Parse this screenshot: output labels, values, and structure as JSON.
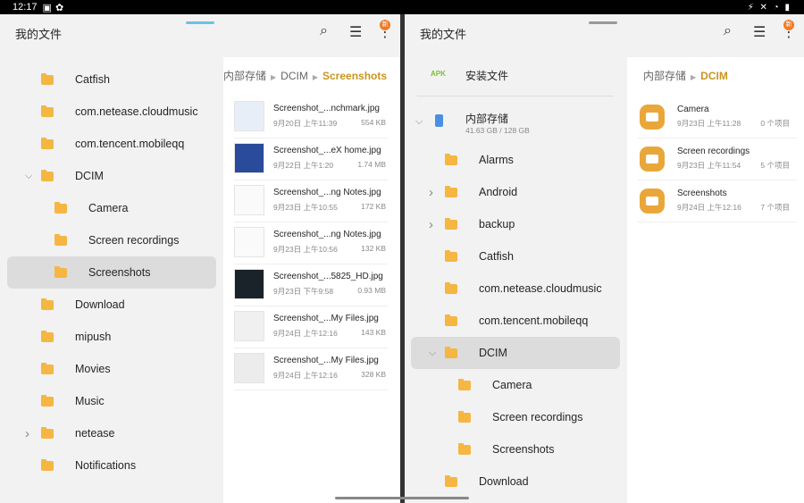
{
  "status": {
    "time": "12:17",
    "icons": [
      "gallery-icon",
      "settings-icon"
    ],
    "right_icons": "⚡ ✕ ◔ ▮"
  },
  "left": {
    "title": "我的文件",
    "badge": "新",
    "tree": [
      {
        "label": "Catfish",
        "level": 0
      },
      {
        "label": "com.netease.cloudmusic",
        "level": 0
      },
      {
        "label": "com.tencent.mobileqq",
        "level": 0
      },
      {
        "label": "DCIM",
        "level": 0,
        "expanded": true
      },
      {
        "label": "Camera",
        "level": 1
      },
      {
        "label": "Screen recordings",
        "level": 1
      },
      {
        "label": "Screenshots",
        "level": 1,
        "selected": true
      },
      {
        "label": "Download",
        "level": 0
      },
      {
        "label": "mipush",
        "level": 0
      },
      {
        "label": "Movies",
        "level": 0
      },
      {
        "label": "Music",
        "level": 0
      },
      {
        "label": "netease",
        "level": 0,
        "collapsed": true
      },
      {
        "label": "Notifications",
        "level": 0
      }
    ],
    "breadcrumb": [
      "内部存储",
      "DCIM",
      "Screenshots"
    ],
    "files": [
      {
        "name": "Screenshot_...nchmark.jpg",
        "date": "9月20日 上午11:39",
        "size": "554 KB",
        "thumb": "#e8eef8"
      },
      {
        "name": "Screenshot_...eX home.jpg",
        "date": "9月22日 上午1:20",
        "size": "1.74 MB",
        "thumb": "#2a4a9a"
      },
      {
        "name": "Screenshot_...ng Notes.jpg",
        "date": "9月23日 上午10:55",
        "size": "172 KB",
        "thumb": "#fafafa"
      },
      {
        "name": "Screenshot_...ng Notes.jpg",
        "date": "9月23日 上午10:56",
        "size": "132 KB",
        "thumb": "#fafafa"
      },
      {
        "name": "Screenshot_...5825_HD.jpg",
        "date": "9月23日 下午9:58",
        "size": "0.93 MB",
        "thumb": "#1a222a"
      },
      {
        "name": "Screenshot_...My Files.jpg",
        "date": "9月24日 上午12:16",
        "size": "143 KB",
        "thumb": "#f0f0f0"
      },
      {
        "name": "Screenshot_...My Files.jpg",
        "date": "9月24日 上午12:16",
        "size": "328 KB",
        "thumb": "#ececec"
      }
    ]
  },
  "right": {
    "title": "我的文件",
    "badge": "新",
    "apk": {
      "icon": "APK",
      "label": "安装文件"
    },
    "storage": {
      "label": "内部存储",
      "detail": "41.63 GB / 128 GB"
    },
    "tree": [
      {
        "label": "Alarms",
        "level": 0
      },
      {
        "label": "Android",
        "level": 0,
        "collapsed": true
      },
      {
        "label": "backup",
        "level": 0,
        "collapsed": true
      },
      {
        "label": "Catfish",
        "level": 0
      },
      {
        "label": "com.netease.cloudmusic",
        "level": 0
      },
      {
        "label": "com.tencent.mobileqq",
        "level": 0
      },
      {
        "label": "DCIM",
        "level": 0,
        "expanded": true,
        "selected": true
      },
      {
        "label": "Camera",
        "level": 1
      },
      {
        "label": "Screen recordings",
        "level": 1
      },
      {
        "label": "Screenshots",
        "level": 1
      },
      {
        "label": "Download",
        "level": 0
      }
    ],
    "breadcrumb": [
      "内部存储",
      "DCIM"
    ],
    "folders": [
      {
        "name": "Camera",
        "date": "9月23日 上午11:28",
        "count": "0 个项目"
      },
      {
        "name": "Screen recordings",
        "date": "9月23日 上午11:54",
        "count": "5 个项目"
      },
      {
        "name": "Screenshots",
        "date": "9月24日 上午12:16",
        "count": "7 个项目"
      }
    ]
  },
  "colors": {
    "accent": "#c8961e",
    "folder": "#f5b642",
    "badge": "#f07a25",
    "active_handle": "#6ec1e4"
  }
}
